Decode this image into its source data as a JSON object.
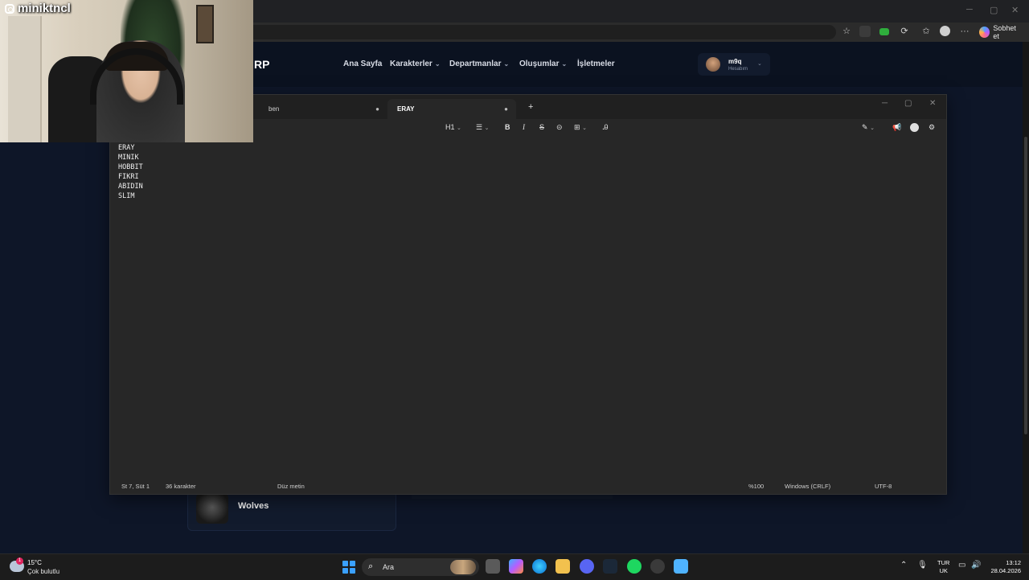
{
  "streamer": {
    "name": "miniktncl"
  },
  "browser": {
    "chat_button_label": "Sobhet et",
    "toolbar_icons": [
      "star-icon",
      "extension-icon",
      "extension-green-icon",
      "extension-puzzle-icon",
      "favorites-icon",
      "profile-icon",
      "more-icon"
    ]
  },
  "site": {
    "logo": "RP",
    "nav": {
      "home": "Ana Sayfa",
      "characters": "Karakterler",
      "departments": "Departmanlar",
      "creations": "Oluşumlar",
      "businesses": "İşletmeler"
    },
    "account": {
      "name": "m9q",
      "subtitle": "Hesabım"
    },
    "card": {
      "name": "Wolves"
    }
  },
  "notepad": {
    "tabs": [
      {
        "label": "ben",
        "active": false
      },
      {
        "label": "ERAY",
        "active": true
      }
    ],
    "toolbar": {
      "heading": "H1"
    },
    "content": [
      "ERAY",
      "MINIK",
      "HOBBIT",
      "FIKRI",
      "ABIDIN",
      "SLIM"
    ],
    "status": {
      "position": "St 7, Süt 1",
      "chars": "36 karakter",
      "format": "Düz metin",
      "zoom": "%100",
      "line_ending": "Windows (CRLF)",
      "encoding": "UTF-8"
    }
  },
  "taskbar": {
    "weather": {
      "temp": "15°C",
      "desc": "Çok bulutlu",
      "badge": "1"
    },
    "search_placeholder": "Ara",
    "lang": {
      "line1": "TUR",
      "line2": "UK"
    },
    "clock": {
      "time": "13:12",
      "date": "28.04.2026"
    }
  }
}
